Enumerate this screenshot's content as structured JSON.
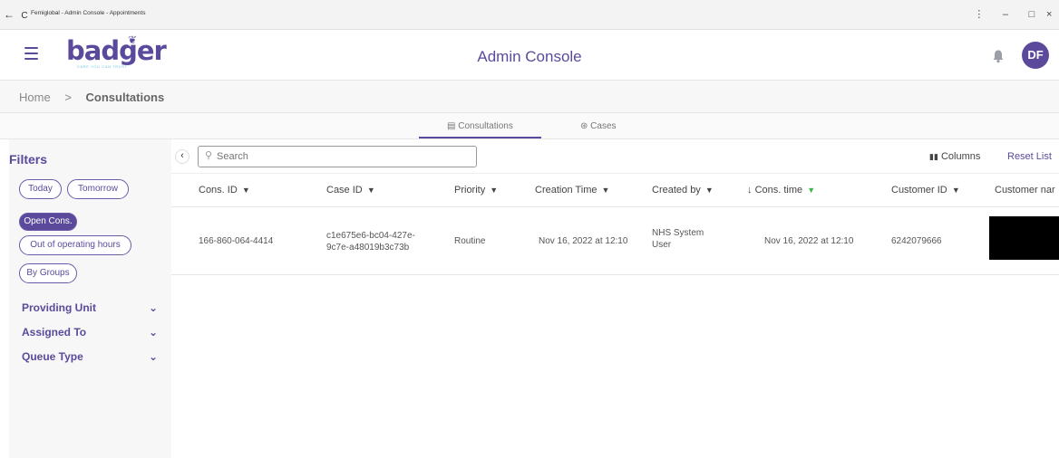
{
  "browser": {
    "nav_back": "←",
    "nav_reload": "C",
    "tab_title": "Femiglobal - Admin Console - Appointments",
    "menu_glyph": "⋮",
    "minimize": "–",
    "maximize": "□",
    "close": "×"
  },
  "header": {
    "logo_text": "badger",
    "logo_tagline": "CARE YOU CAN TRUST",
    "title": "Admin Console",
    "avatar_initials": "DF",
    "brand_color": "#5b4a9b",
    "icons": [
      "menu-icon",
      "bell-icon"
    ]
  },
  "breadcrumb": {
    "home": "Home",
    "separator": ">",
    "current": "Consultations"
  },
  "tabs": [
    {
      "label": "Consultations",
      "icon": "clipboard-icon",
      "active": true
    },
    {
      "label": "Cases",
      "icon": "cases-icon",
      "active": false
    }
  ],
  "filters": {
    "title": "Filters",
    "chips": [
      {
        "label": "Today",
        "active": false
      },
      {
        "label": "Tomorrow",
        "active": false
      },
      {
        "label": "Open Cons.",
        "active": true
      },
      {
        "label": "Out of operating hours",
        "active": false
      },
      {
        "label": "By Groups",
        "active": false
      }
    ],
    "sections": [
      "Providing Unit",
      "Assigned To",
      "Queue Type"
    ]
  },
  "toolbar": {
    "search_placeholder": "Search",
    "columns_label": "Columns",
    "reset_label": "Reset List"
  },
  "table": {
    "headers": [
      {
        "label": "Cons. ID",
        "filter": "funnel"
      },
      {
        "label": "Case ID",
        "filter": "funnel"
      },
      {
        "label": "Priority",
        "filter": "funnel"
      },
      {
        "label": "Creation Time",
        "filter": "funnel"
      },
      {
        "label": "Created by",
        "filter": "funnel"
      },
      {
        "label": "Cons. time",
        "filter": "funnel-active",
        "sort": "↓"
      },
      {
        "label": "Customer ID",
        "filter": "funnel"
      },
      {
        "label": "Customer nar",
        "filter": "none"
      }
    ],
    "rows": [
      {
        "cons_id": "166-860-064-4414",
        "case_id_line1": "c1e675e6-bc04-427e-",
        "case_id_line2": "9c7e-a48019b3c73b",
        "priority": "Routine",
        "creation_time": "Nov 16, 2022 at 12:10",
        "created_by_line1": "NHS System",
        "created_by_line2": "User",
        "cons_time": "Nov 16, 2022 at 12:10",
        "customer_id": "6242079666"
      }
    ]
  }
}
